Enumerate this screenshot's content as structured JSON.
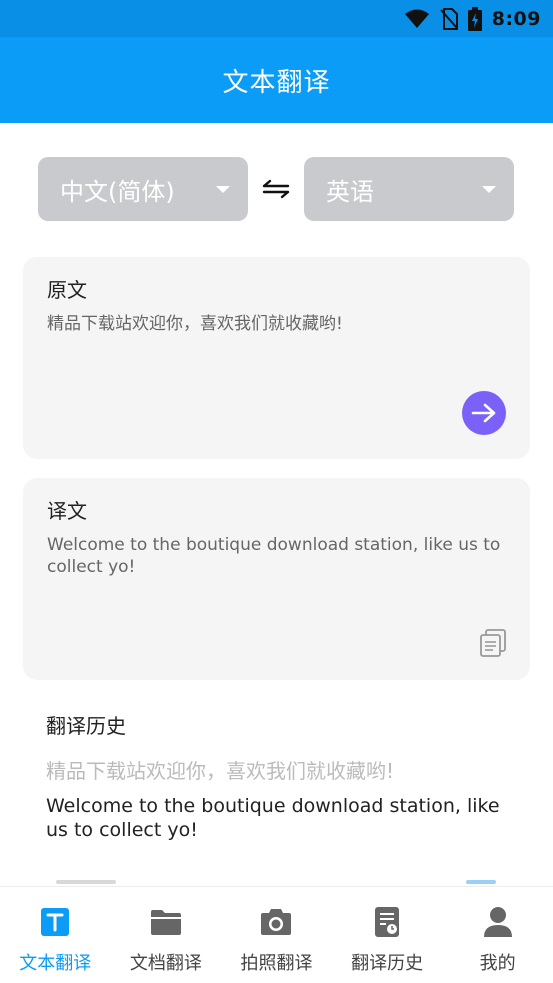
{
  "status_bar": {
    "time": "8:09"
  },
  "app_bar": {
    "title": "文本翻译"
  },
  "languages": {
    "source": "中文(简体)",
    "target": "英语",
    "swap_glyph": "⇋"
  },
  "source_card": {
    "label": "原文",
    "text": "精品下载站欢迎你，喜欢我们就收藏哟!"
  },
  "target_card": {
    "label": "译文",
    "text": "Welcome to the boutique download station, like us to collect yo!"
  },
  "history": {
    "title": "翻译历史",
    "entries": [
      {
        "source": "精品下载站欢迎你，喜欢我们就收藏哟!",
        "target": "Welcome to the boutique download station, like us to collect yo!"
      }
    ]
  },
  "tabs": [
    {
      "label": "文本翻译",
      "icon": "text-translate-icon",
      "active": true
    },
    {
      "label": "文档翻译",
      "icon": "folder-icon",
      "active": false
    },
    {
      "label": "拍照翻译",
      "icon": "camera-icon",
      "active": false
    },
    {
      "label": "翻译历史",
      "icon": "history-icon",
      "active": false
    },
    {
      "label": "我的",
      "icon": "user-icon",
      "active": false
    }
  ],
  "colors": {
    "primary": "#0b9cf7",
    "status_bar": "#0a8fe6",
    "accent_button": "#7b61f7",
    "select_bg": "#c8cace",
    "card_bg": "#f5f5f5",
    "inactive_icon": "#666666"
  }
}
